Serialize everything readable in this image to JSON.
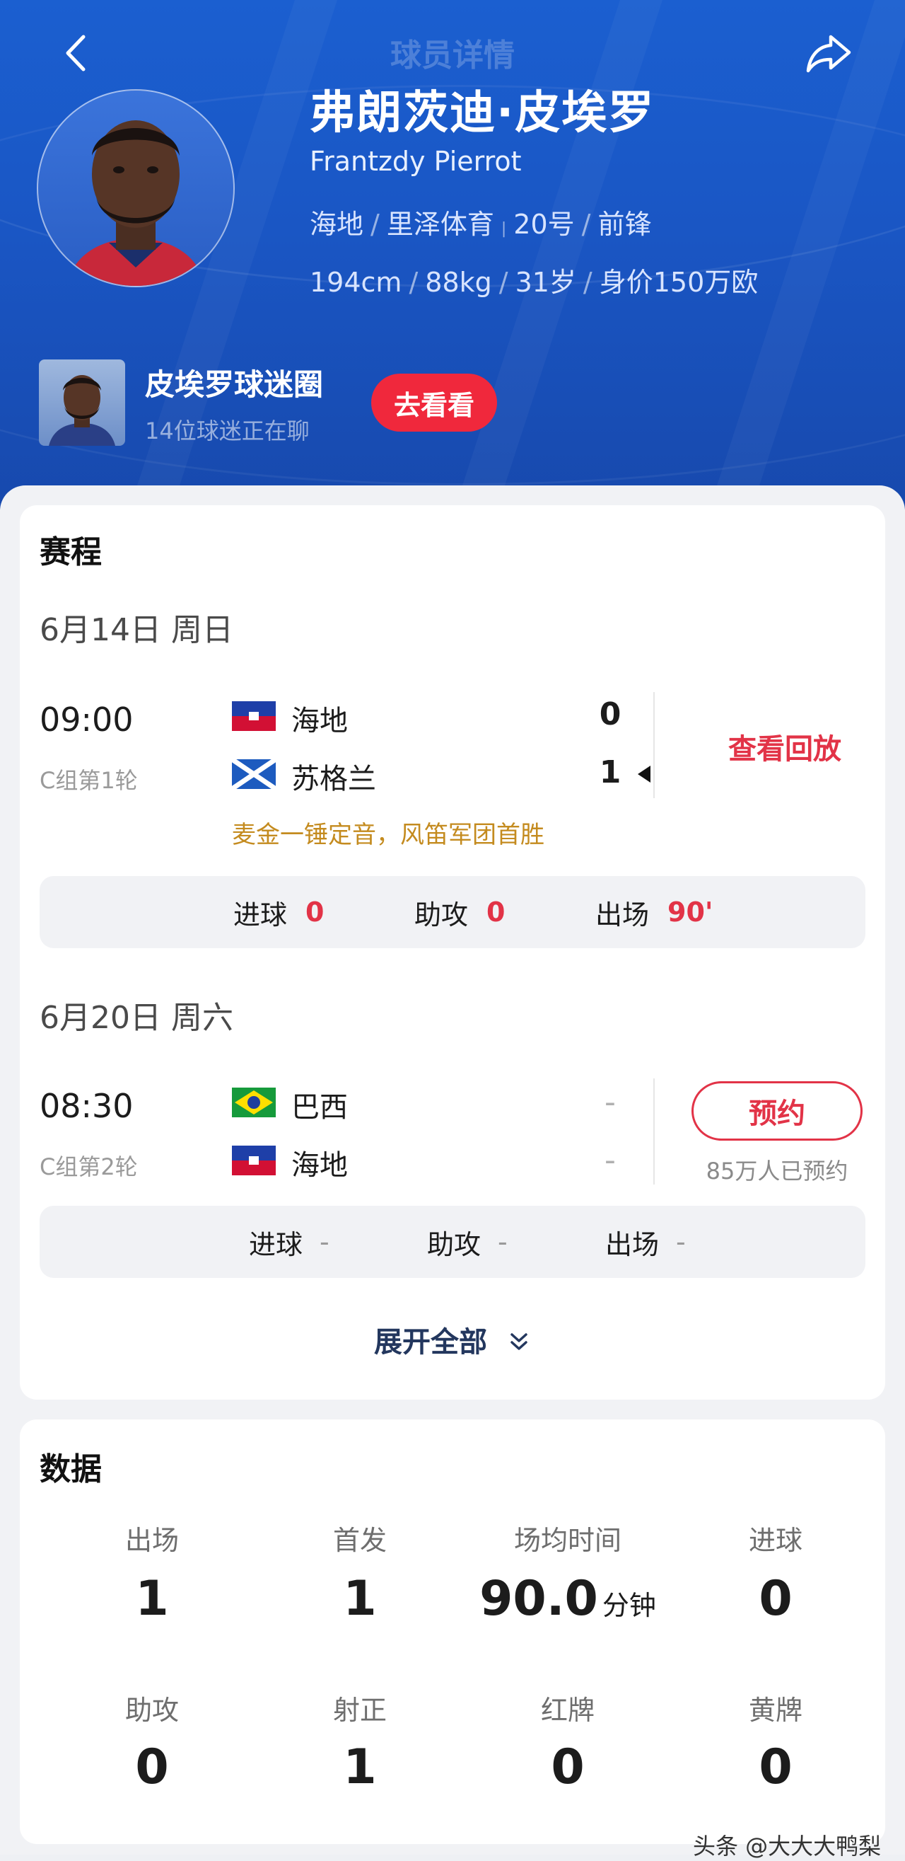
{
  "nav": {
    "title": "球员详情"
  },
  "player": {
    "name_cn": "弗朗茨迪·皮埃罗",
    "name_en": "Frantzdy Pierrot",
    "country": "海地",
    "club": "里泽体育",
    "number": "20号",
    "position": "前锋",
    "height": "194cm",
    "weight": "88kg",
    "age": "31岁",
    "value": "身价150万欧"
  },
  "fan_circle": {
    "title": "皮埃罗球迷圈",
    "subtitle": "14位球迷正在聊",
    "button": "去看看"
  },
  "schedule": {
    "title": "赛程",
    "matches": [
      {
        "date": "6月14日 周日",
        "time": "09:00",
        "round": "C组第1轮",
        "home_team": "海地",
        "away_team": "苏格兰",
        "home_score": "0",
        "away_score": "1",
        "action": "查看回放",
        "headline": "麦金一锤定音，风笛军团首胜",
        "stats": {
          "goals_label": "进球",
          "goals": "0",
          "assists_label": "助攻",
          "assists": "0",
          "minutes_label": "出场",
          "minutes": "90'"
        }
      },
      {
        "date": "6月20日 周六",
        "time": "08:30",
        "round": "C组第2轮",
        "home_team": "巴西",
        "away_team": "海地",
        "home_score": "-",
        "away_score": "-",
        "action": "预约",
        "reserve_count": "85万人已预约",
        "stats": {
          "goals_label": "进球",
          "goals": "-",
          "assists_label": "助攻",
          "assists": "-",
          "minutes_label": "出场",
          "minutes": "-"
        }
      }
    ],
    "expand_label": "展开全部"
  },
  "data_section": {
    "title": "数据",
    "stats": [
      {
        "label": "出场",
        "value": "1"
      },
      {
        "label": "首发",
        "value": "1"
      },
      {
        "label": "场均时间",
        "value": "90.0",
        "unit": "分钟"
      },
      {
        "label": "进球",
        "value": "0"
      },
      {
        "label": "助攻",
        "value": "0"
      },
      {
        "label": "射正",
        "value": "1"
      },
      {
        "label": "红牌",
        "value": "0"
      },
      {
        "label": "黄牌",
        "value": "0"
      }
    ]
  },
  "watermark": "头条 @大大大鸭梨",
  "colors": {
    "hero_blue": "#1a56c4",
    "accent_red": "#e23347",
    "button_red": "#f0283c",
    "headline_gold": "#c48b1f"
  },
  "icons": [
    "back-icon",
    "share-icon",
    "chevron-double-down-icon"
  ]
}
